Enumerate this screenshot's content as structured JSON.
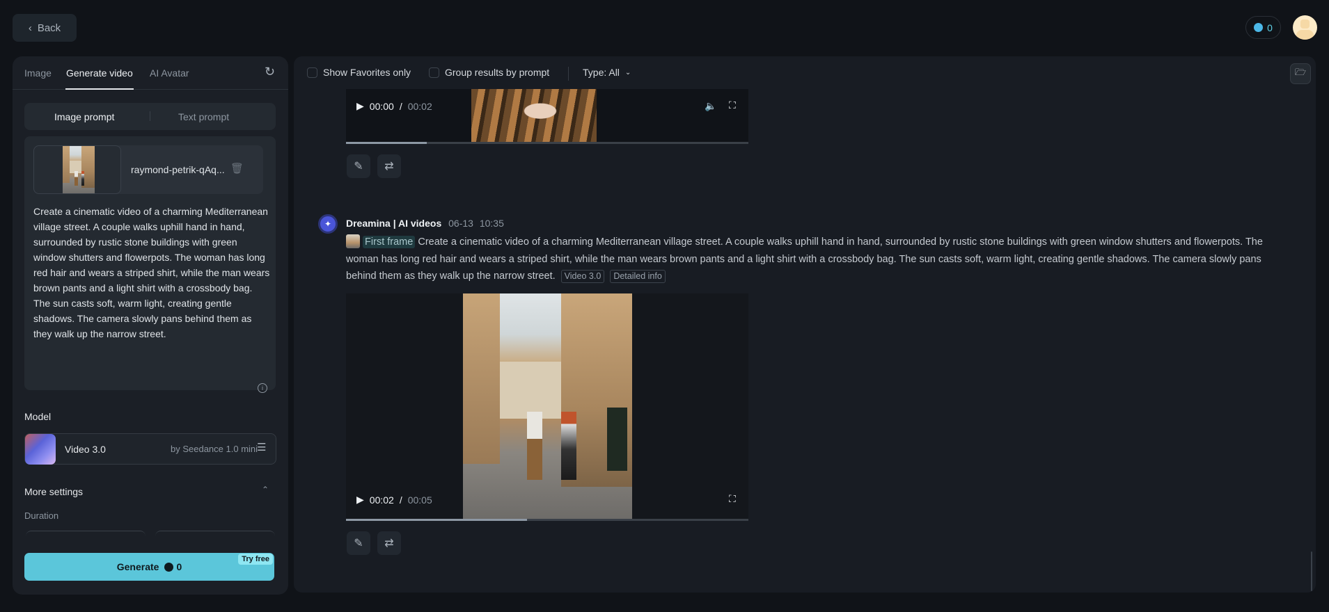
{
  "header": {
    "back_label": "Back",
    "credits": "0"
  },
  "left_panel": {
    "tabs": [
      {
        "label": "Image"
      },
      {
        "label": "Generate video"
      },
      {
        "label": "AI Avatar"
      }
    ],
    "prompt_modes": [
      {
        "label": "Image prompt"
      },
      {
        "label": "Text prompt"
      }
    ],
    "uploaded_image_name": "raymond-petrik-qAq...",
    "prompt_text": "Create a cinematic video of a charming Mediterranean village street. A couple walks uphill hand in hand, surrounded by rustic stone buildings with green window shutters and flowerpots. The woman has long red hair and wears a striped shirt, while the man wears brown pants and a light shirt with a crossbody bag. The sun casts soft, warm light, creating gentle shadows. The camera slowly pans behind them as they walk up the narrow street.",
    "model_label": "Model",
    "model_name": "Video 3.0",
    "model_provider": "by Seedance 1.0 mini",
    "more_settings_label": "More settings",
    "duration_label": "Duration",
    "generate_label": "Generate",
    "generate_cost": "0",
    "try_free_label": "Try free",
    "accent": "#5bc6da"
  },
  "toolbar": {
    "favorites_label": "Show Favorites only",
    "group_label": "Group results by prompt",
    "type_label": "Type: All"
  },
  "results": [
    {
      "time_current": "00:00",
      "time_total": "00:02",
      "progress": 0.2
    },
    {
      "author": "Dreamina | AI videos",
      "date": "06-13",
      "time": "10:35",
      "first_frame_label": "First frame",
      "prompt": "Create a cinematic video of a charming Mediterranean village street. A couple walks uphill hand in hand, surrounded by rustic stone buildings with green window shutters and flowerpots. The woman has long red hair and wears a striped shirt, while the man wears brown pants and a light shirt with a crossbody bag. The sun casts soft, warm light, creating gentle shadows. The camera slowly pans behind them as they walk up the narrow street.",
      "model_tag": "Video 3.0",
      "details_tag": "Detailed info",
      "time_current": "00:02",
      "time_total": "00:05",
      "progress": 0.45
    }
  ]
}
